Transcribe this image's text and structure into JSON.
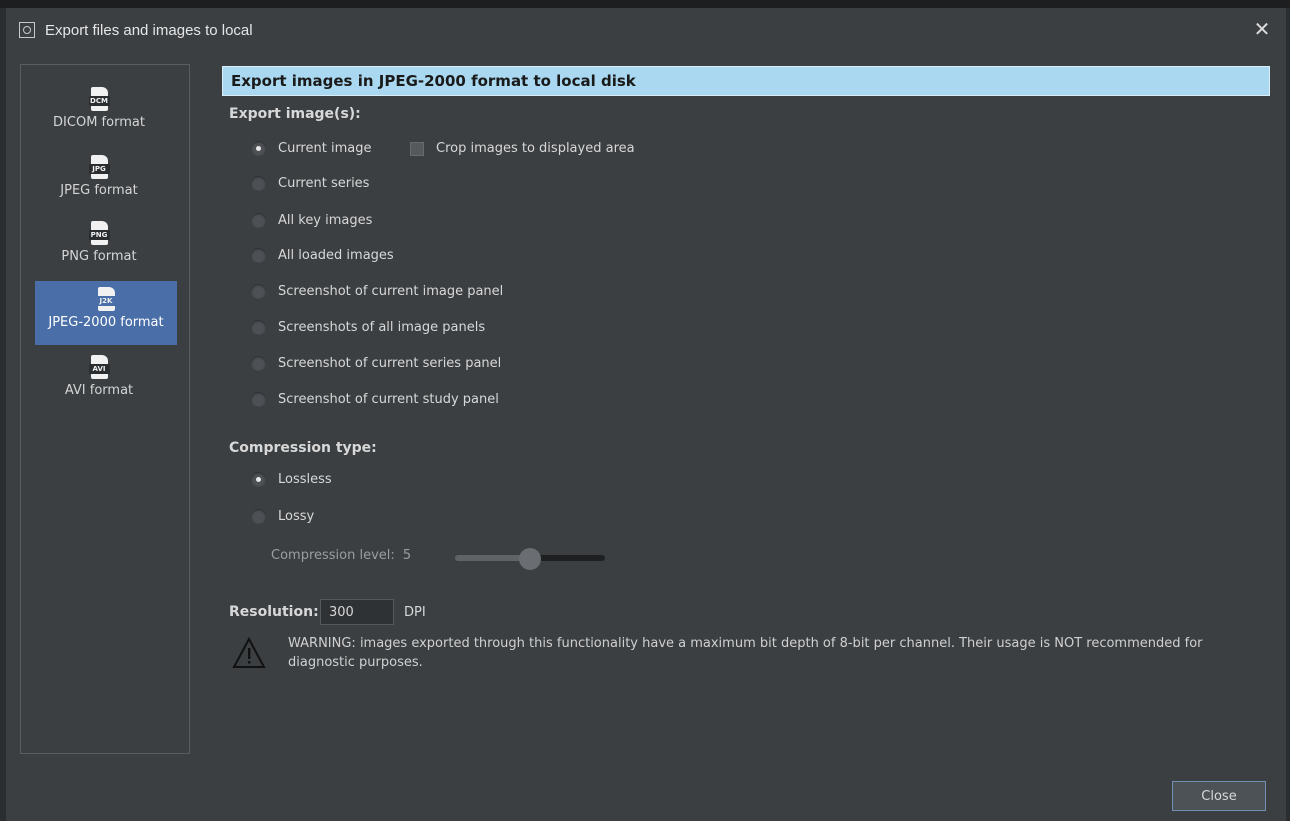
{
  "window": {
    "title": "Export files and images to local"
  },
  "sidebar": {
    "items": [
      {
        "badge": "DCM",
        "label": "DICOM format",
        "active": false
      },
      {
        "badge": "JPG",
        "label": "JPEG format",
        "active": false
      },
      {
        "badge": "PNG",
        "label": "PNG format",
        "active": false
      },
      {
        "badge": "J2K",
        "label": "JPEG-2000 format",
        "active": true
      },
      {
        "badge": "AVI",
        "label": "AVI format",
        "active": false
      }
    ]
  },
  "main": {
    "header": "Export images in JPEG-2000 format to local disk",
    "export_section": {
      "label": "Export image(s):",
      "options": [
        {
          "label": "Current image",
          "checked": true
        },
        {
          "label": "Current series",
          "checked": false
        },
        {
          "label": "All key images",
          "checked": false
        },
        {
          "label": "All loaded images",
          "checked": false
        },
        {
          "label": "Screenshot of current image panel",
          "checked": false
        },
        {
          "label": "Screenshots of all image panels",
          "checked": false
        },
        {
          "label": "Screenshot of current series panel",
          "checked": false
        },
        {
          "label": "Screenshot of current study panel",
          "checked": false
        }
      ],
      "crop_checkbox": {
        "label": "Crop images to displayed area",
        "checked": false
      }
    },
    "compression": {
      "label": "Compression type:",
      "options": [
        {
          "label": "Lossless",
          "checked": true
        },
        {
          "label": "Lossy",
          "checked": false
        }
      ],
      "level_label": "Compression level:",
      "level_value": "5"
    },
    "resolution": {
      "label": "Resolution:",
      "value": "300",
      "unit": "DPI"
    },
    "warning": "WARNING: images exported through this functionality have a maximum bit depth of 8-bit per channel. Their usage is NOT recommended for diagnostic purposes."
  },
  "footer": {
    "close_label": "Close"
  }
}
